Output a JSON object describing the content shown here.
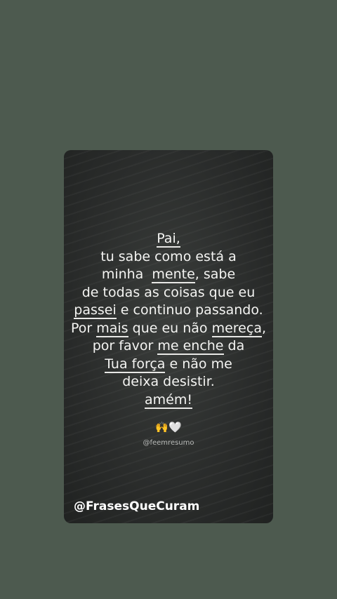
{
  "quote": {
    "l1": "Pai,",
    "l2": "tu sabe como está a",
    "l3a": "minha  ",
    "l3b": "mente",
    "l3c": ", sabe",
    "l4": "de todas as coisas que eu",
    "l5a": "passei",
    "l5b": " e continuo passando.",
    "l6a": "Por ",
    "l6b": "mais",
    "l6c": " que eu não ",
    "l6d": "mereça",
    "l6e": ",",
    "l7a": "por favor ",
    "l7b": "me enche",
    "l7c": " da",
    "l8a": "Tua força",
    "l8b": " e não me",
    "l9": "deixa desistir.",
    "l10": "amém!"
  },
  "emoji": {
    "hands": "🙌",
    "heart": "🤍"
  },
  "handle": "@feemresumo",
  "footer": "@FrasesQueCuram"
}
